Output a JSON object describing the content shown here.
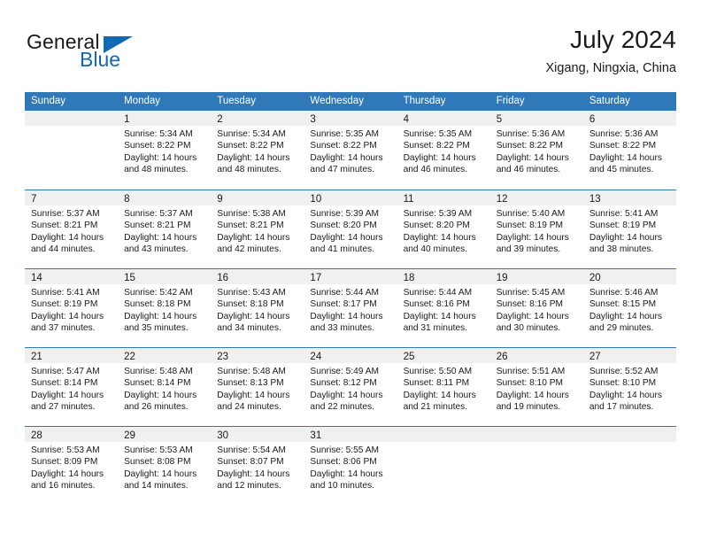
{
  "brand": {
    "name_top": "General",
    "name_bottom": "Blue",
    "triangle_color": "#1268b3"
  },
  "header": {
    "title": "July 2024",
    "subtitle": "Xigang, Ningxia, China"
  },
  "theme": {
    "header_blue": "#3079b8",
    "daynum_band": "#f0f0f0",
    "text": "#1a1a1a"
  },
  "weekdays": [
    "Sunday",
    "Monday",
    "Tuesday",
    "Wednesday",
    "Thursday",
    "Friday",
    "Saturday"
  ],
  "weeks": [
    [
      {
        "day": "",
        "lines": []
      },
      {
        "day": "1",
        "lines": [
          "Sunrise: 5:34 AM",
          "Sunset: 8:22 PM",
          "Daylight: 14 hours",
          "and 48 minutes."
        ]
      },
      {
        "day": "2",
        "lines": [
          "Sunrise: 5:34 AM",
          "Sunset: 8:22 PM",
          "Daylight: 14 hours",
          "and 48 minutes."
        ]
      },
      {
        "day": "3",
        "lines": [
          "Sunrise: 5:35 AM",
          "Sunset: 8:22 PM",
          "Daylight: 14 hours",
          "and 47 minutes."
        ]
      },
      {
        "day": "4",
        "lines": [
          "Sunrise: 5:35 AM",
          "Sunset: 8:22 PM",
          "Daylight: 14 hours",
          "and 46 minutes."
        ]
      },
      {
        "day": "5",
        "lines": [
          "Sunrise: 5:36 AM",
          "Sunset: 8:22 PM",
          "Daylight: 14 hours",
          "and 46 minutes."
        ]
      },
      {
        "day": "6",
        "lines": [
          "Sunrise: 5:36 AM",
          "Sunset: 8:22 PM",
          "Daylight: 14 hours",
          "and 45 minutes."
        ]
      }
    ],
    [
      {
        "day": "7",
        "lines": [
          "Sunrise: 5:37 AM",
          "Sunset: 8:21 PM",
          "Daylight: 14 hours",
          "and 44 minutes."
        ]
      },
      {
        "day": "8",
        "lines": [
          "Sunrise: 5:37 AM",
          "Sunset: 8:21 PM",
          "Daylight: 14 hours",
          "and 43 minutes."
        ]
      },
      {
        "day": "9",
        "lines": [
          "Sunrise: 5:38 AM",
          "Sunset: 8:21 PM",
          "Daylight: 14 hours",
          "and 42 minutes."
        ]
      },
      {
        "day": "10",
        "lines": [
          "Sunrise: 5:39 AM",
          "Sunset: 8:20 PM",
          "Daylight: 14 hours",
          "and 41 minutes."
        ]
      },
      {
        "day": "11",
        "lines": [
          "Sunrise: 5:39 AM",
          "Sunset: 8:20 PM",
          "Daylight: 14 hours",
          "and 40 minutes."
        ]
      },
      {
        "day": "12",
        "lines": [
          "Sunrise: 5:40 AM",
          "Sunset: 8:19 PM",
          "Daylight: 14 hours",
          "and 39 minutes."
        ]
      },
      {
        "day": "13",
        "lines": [
          "Sunrise: 5:41 AM",
          "Sunset: 8:19 PM",
          "Daylight: 14 hours",
          "and 38 minutes."
        ]
      }
    ],
    [
      {
        "day": "14",
        "lines": [
          "Sunrise: 5:41 AM",
          "Sunset: 8:19 PM",
          "Daylight: 14 hours",
          "and 37 minutes."
        ]
      },
      {
        "day": "15",
        "lines": [
          "Sunrise: 5:42 AM",
          "Sunset: 8:18 PM",
          "Daylight: 14 hours",
          "and 35 minutes."
        ]
      },
      {
        "day": "16",
        "lines": [
          "Sunrise: 5:43 AM",
          "Sunset: 8:18 PM",
          "Daylight: 14 hours",
          "and 34 minutes."
        ]
      },
      {
        "day": "17",
        "lines": [
          "Sunrise: 5:44 AM",
          "Sunset: 8:17 PM",
          "Daylight: 14 hours",
          "and 33 minutes."
        ]
      },
      {
        "day": "18",
        "lines": [
          "Sunrise: 5:44 AM",
          "Sunset: 8:16 PM",
          "Daylight: 14 hours",
          "and 31 minutes."
        ]
      },
      {
        "day": "19",
        "lines": [
          "Sunrise: 5:45 AM",
          "Sunset: 8:16 PM",
          "Daylight: 14 hours",
          "and 30 minutes."
        ]
      },
      {
        "day": "20",
        "lines": [
          "Sunrise: 5:46 AM",
          "Sunset: 8:15 PM",
          "Daylight: 14 hours",
          "and 29 minutes."
        ]
      }
    ],
    [
      {
        "day": "21",
        "lines": [
          "Sunrise: 5:47 AM",
          "Sunset: 8:14 PM",
          "Daylight: 14 hours",
          "and 27 minutes."
        ]
      },
      {
        "day": "22",
        "lines": [
          "Sunrise: 5:48 AM",
          "Sunset: 8:14 PM",
          "Daylight: 14 hours",
          "and 26 minutes."
        ]
      },
      {
        "day": "23",
        "lines": [
          "Sunrise: 5:48 AM",
          "Sunset: 8:13 PM",
          "Daylight: 14 hours",
          "and 24 minutes."
        ]
      },
      {
        "day": "24",
        "lines": [
          "Sunrise: 5:49 AM",
          "Sunset: 8:12 PM",
          "Daylight: 14 hours",
          "and 22 minutes."
        ]
      },
      {
        "day": "25",
        "lines": [
          "Sunrise: 5:50 AM",
          "Sunset: 8:11 PM",
          "Daylight: 14 hours",
          "and 21 minutes."
        ]
      },
      {
        "day": "26",
        "lines": [
          "Sunrise: 5:51 AM",
          "Sunset: 8:10 PM",
          "Daylight: 14 hours",
          "and 19 minutes."
        ]
      },
      {
        "day": "27",
        "lines": [
          "Sunrise: 5:52 AM",
          "Sunset: 8:10 PM",
          "Daylight: 14 hours",
          "and 17 minutes."
        ]
      }
    ],
    [
      {
        "day": "28",
        "lines": [
          "Sunrise: 5:53 AM",
          "Sunset: 8:09 PM",
          "Daylight: 14 hours",
          "and 16 minutes."
        ]
      },
      {
        "day": "29",
        "lines": [
          "Sunrise: 5:53 AM",
          "Sunset: 8:08 PM",
          "Daylight: 14 hours",
          "and 14 minutes."
        ]
      },
      {
        "day": "30",
        "lines": [
          "Sunrise: 5:54 AM",
          "Sunset: 8:07 PM",
          "Daylight: 14 hours",
          "and 12 minutes."
        ]
      },
      {
        "day": "31",
        "lines": [
          "Sunrise: 5:55 AM",
          "Sunset: 8:06 PM",
          "Daylight: 14 hours",
          "and 10 minutes."
        ]
      },
      {
        "day": "",
        "lines": []
      },
      {
        "day": "",
        "lines": []
      },
      {
        "day": "",
        "lines": []
      }
    ]
  ]
}
